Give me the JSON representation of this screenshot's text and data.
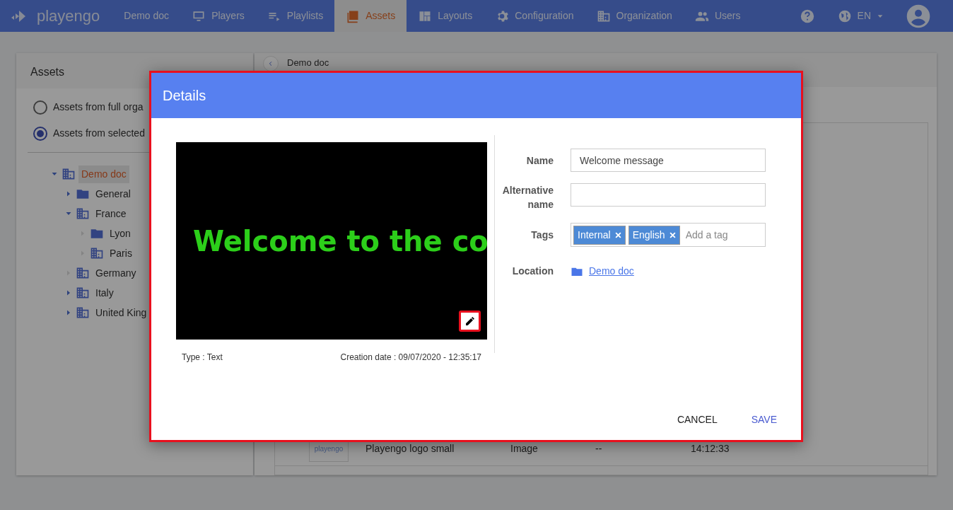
{
  "navbar": {
    "brand": "playengo",
    "items": [
      {
        "label": "Demo doc",
        "selected": false
      },
      {
        "label": "Players",
        "selected": false
      },
      {
        "label": "Playlists",
        "selected": false
      },
      {
        "label": "Assets",
        "selected": true
      },
      {
        "label": "Layouts",
        "selected": false
      },
      {
        "label": "Configuration",
        "selected": false
      },
      {
        "label": "Organization",
        "selected": false
      },
      {
        "label": "Users",
        "selected": false
      }
    ],
    "language": "EN"
  },
  "assets_panel": {
    "title": "Assets",
    "scope_options": [
      {
        "label": "Assets from full orga",
        "selected": false
      },
      {
        "label": "Assets from selected",
        "selected": true
      }
    ],
    "tree": [
      {
        "label": "Demo doc",
        "kind": "building",
        "expandable": true,
        "expanded": true,
        "selected": true,
        "children": [
          {
            "label": "General",
            "kind": "folder",
            "expandable": true,
            "expanded": false,
            "selected": false
          },
          {
            "label": "France",
            "kind": "building",
            "expandable": true,
            "expanded": true,
            "selected": false,
            "children": [
              {
                "label": "Lyon",
                "kind": "folder",
                "expandable": false,
                "expanded": false,
                "selected": false
              },
              {
                "label": "Paris",
                "kind": "building",
                "expandable": false,
                "expanded": false,
                "selected": false
              }
            ]
          },
          {
            "label": "Germany",
            "kind": "building",
            "expandable": false,
            "expanded": false,
            "selected": false
          },
          {
            "label": "Italy",
            "kind": "building",
            "expandable": true,
            "expanded": false,
            "selected": false
          },
          {
            "label": "United King",
            "kind": "building",
            "expandable": true,
            "expanded": false,
            "selected": false
          }
        ]
      }
    ]
  },
  "content_panel": {
    "title": "Demo doc",
    "rows": [
      {
        "thumbnail": "playengo",
        "name": "Playengo logo small",
        "type": "Image",
        "column_4": "--",
        "date": "14:12:33"
      }
    ]
  },
  "dialog": {
    "title": "Details",
    "preview_text": "Welcome to the co",
    "type": "Type : Text",
    "creation_date": "Creation date : 09/07/2020 - 12:35:17",
    "fields": [
      {
        "label": "Name",
        "kind": "text",
        "value": "Welcome message"
      },
      {
        "label": "Alternative name",
        "kind": "text"
      },
      {
        "label": "Tags",
        "kind": "tags",
        "tags": [
          "Internal",
          "English"
        ],
        "placeholder": "Add a tag"
      },
      {
        "label": "Location",
        "kind": "link",
        "value": "Demo doc"
      }
    ],
    "buttons": [
      {
        "label": "CANCEL",
        "primary": false
      },
      {
        "label": "SAVE",
        "primary": true
      }
    ]
  }
}
